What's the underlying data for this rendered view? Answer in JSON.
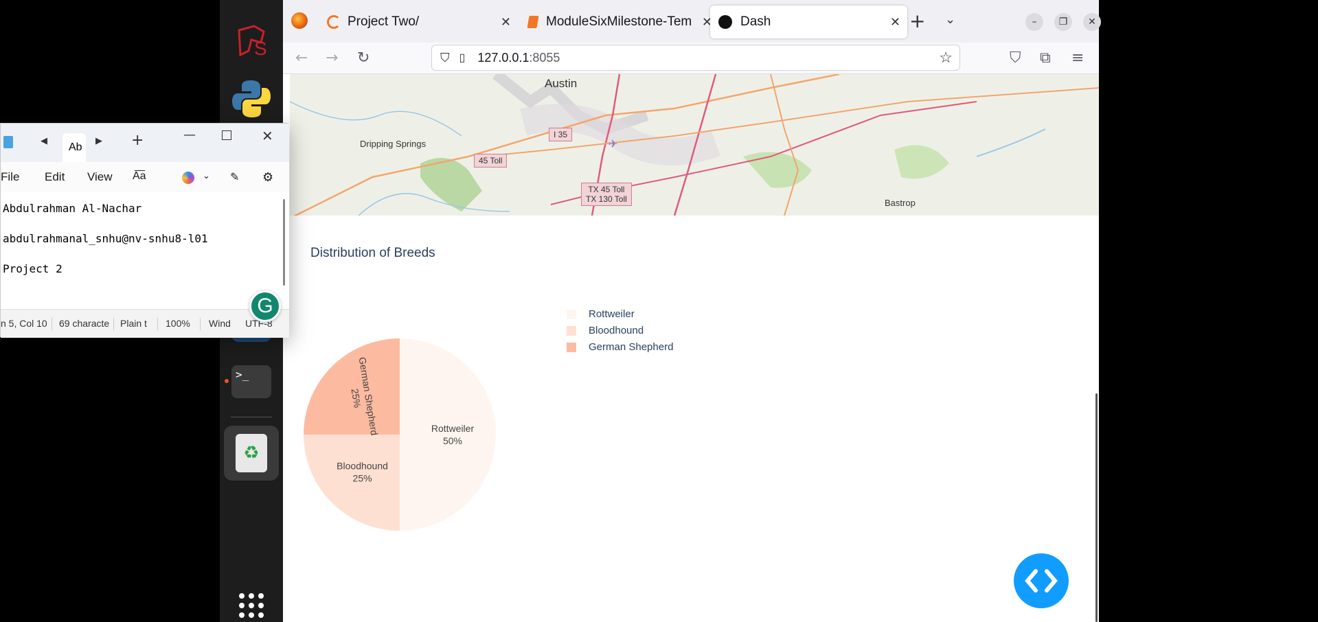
{
  "browser": {
    "tabs": [
      {
        "title": "Project Two/",
        "icon": "jupyter-icon",
        "active": false
      },
      {
        "title": "ModuleSixMilestone-Tem",
        "icon": "notebook-icon",
        "active": false
      },
      {
        "title": "Dash",
        "icon": "dash-icon",
        "active": true
      }
    ],
    "url_host": "127.0.0.1",
    "url_port": ":8055"
  },
  "map": {
    "labels": [
      "Austin",
      "Dripping Springs",
      "Bastrop"
    ],
    "shields": [
      "I 35",
      "45 Toll",
      "TX 45 Toll",
      "TX 130 Toll"
    ]
  },
  "chart_data": {
    "type": "pie",
    "title": "Distribution of Breeds",
    "labels": [
      "Rottweiler",
      "Bloodhound",
      "German Shepherd"
    ],
    "values": [
      50,
      25,
      25
    ],
    "value_labels": [
      "50%",
      "25%",
      "25%"
    ],
    "colors": [
      "#fff5f0",
      "#fee0d2",
      "#fcbba1"
    ],
    "legend_position": "top-right"
  },
  "notepad": {
    "tab_label": "Ab",
    "menu": [
      "File",
      "Edit",
      "View"
    ],
    "lines": [
      "Abdulrahman Al-Nachar",
      "abdulrahmanal_snhu@nv-snhu8-l01",
      "Project 2"
    ],
    "status": {
      "position": "n 5, Col 10",
      "chars": "69 characte",
      "format": "Plain t",
      "zoom": "100%",
      "line_ending": "Wind",
      "encoding": "UTF-8"
    },
    "grammarly_letter": "G"
  },
  "colors": {
    "dash_blue": "#119dff",
    "dock_bg": "#1d1d1d",
    "ubuntu_orange": "#e95420"
  }
}
